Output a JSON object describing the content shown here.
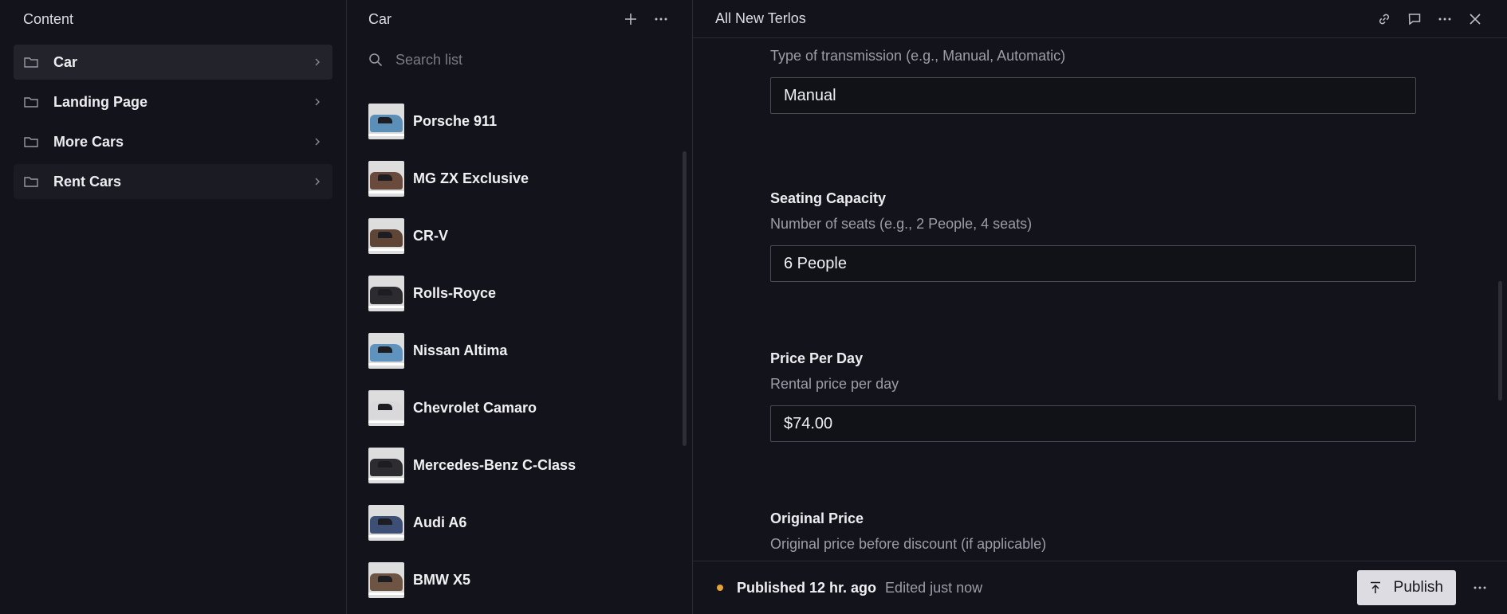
{
  "content_pane": {
    "title": "Content",
    "folders": [
      {
        "label": "Car"
      },
      {
        "label": "Landing Page"
      },
      {
        "label": "More Cars"
      },
      {
        "label": "Rent Cars"
      }
    ]
  },
  "list_pane": {
    "title": "Car",
    "search_placeholder": "Search list",
    "items": [
      {
        "name": "Porsche 911",
        "color": "#5b8fb8"
      },
      {
        "name": "MG ZX Exclusive",
        "color": "#6a4a3c"
      },
      {
        "name": "CR-V",
        "color": "#5e4535"
      },
      {
        "name": "Rolls-Royce",
        "color": "#2b2b30"
      },
      {
        "name": "Nissan Altima",
        "color": "#5f93bd"
      },
      {
        "name": "Chevrolet Camaro",
        "color": "#d9d9dc"
      },
      {
        "name": "Mercedes-Benz C-Class",
        "color": "#2c2c31"
      },
      {
        "name": "Audi A6",
        "color": "#3d4f74"
      },
      {
        "name": "BMW X5",
        "color": "#6d5443"
      }
    ]
  },
  "document": {
    "title": "All New Terlos",
    "fields": [
      {
        "label": "",
        "description": "Type of transmission (e.g., Manual, Automatic)",
        "value": "Manual"
      },
      {
        "label": "Seating Capacity",
        "description": "Number of seats (e.g., 2 People, 4 seats)",
        "value": "6 People"
      },
      {
        "label": "Price Per Day",
        "description": "Rental price per day",
        "value": "$74.00"
      },
      {
        "label": "Original Price",
        "description": "Original price before discount (if applicable)",
        "value": ""
      }
    ],
    "footer": {
      "status": "Published 12 hr. ago",
      "edited": "Edited just now",
      "publish_label": "Publish",
      "status_color": "#e5a13a"
    }
  }
}
